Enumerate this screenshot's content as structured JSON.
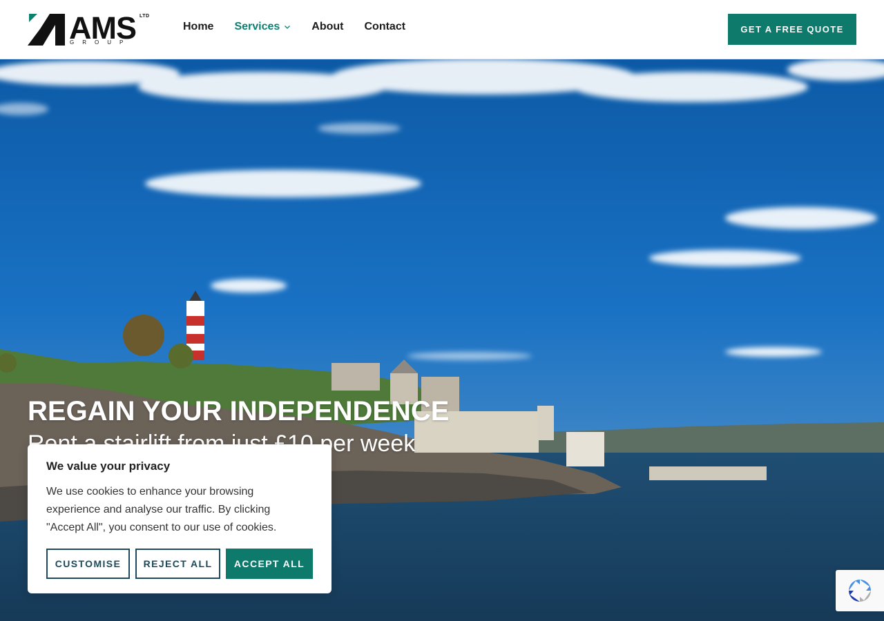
{
  "header": {
    "logo": {
      "wordmark": "AMS",
      "ltd": "LTD",
      "group": "GROUP"
    },
    "nav": [
      {
        "label": "Home"
      },
      {
        "label": "Services",
        "has_dropdown": true,
        "active": true
      },
      {
        "label": "About"
      },
      {
        "label": "Contact"
      }
    ],
    "cta_label": "GET A FREE QUOTE"
  },
  "hero": {
    "title": "REGAIN YOUR INDEPENDENCE",
    "subtitle": "Rent a stairlift from just £10 per week"
  },
  "cookie_banner": {
    "title": "We value your privacy",
    "text": "We use cookies to enhance your browsing experience and analyse our traffic. By clicking \"Accept All\", you consent to our use of cookies.",
    "buttons": {
      "customise": "CUSTOMISE",
      "reject": "REJECT ALL",
      "accept": "ACCEPT ALL"
    }
  },
  "recaptcha": {
    "icon": "recaptcha-icon"
  },
  "colors": {
    "brand_teal": "#0e7a6c",
    "nav_active": "#0e8070",
    "button_outline": "#1b4a5c",
    "text_dark": "#1c1c1c"
  }
}
